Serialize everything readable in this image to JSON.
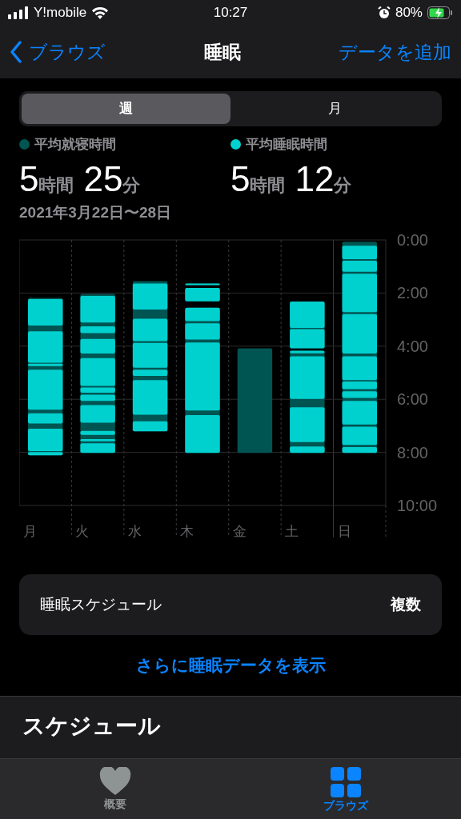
{
  "status_bar": {
    "carrier": "Y!mobile",
    "time": "10:27",
    "battery": "80%"
  },
  "nav": {
    "back": "ブラウズ",
    "title": "睡眠",
    "action": "データを追加"
  },
  "segments": [
    {
      "label": "週",
      "selected": true
    },
    {
      "label": "月",
      "selected": false
    }
  ],
  "stats": [
    {
      "label": "平均就寝時間",
      "color": "#005552",
      "hours": "5",
      "hours_unit": "時間",
      "minutes": "25",
      "minutes_unit": "分"
    },
    {
      "label": "平均睡眠時間",
      "color": "#00d1cf",
      "hours": "5",
      "hours_unit": "時間",
      "minutes": "12",
      "minutes_unit": "分"
    }
  ],
  "date_range": "2021年3月22日〜28日",
  "sleep_chart": {
    "y_labels": [
      "0:00",
      "2:00",
      "4:00",
      "6:00",
      "8:00",
      "10:00"
    ],
    "day_labels": [
      "月",
      "火",
      "水",
      "木",
      "金",
      "土",
      "日"
    ]
  },
  "schedule_row": {
    "label": "睡眠スケジュール",
    "value": "複数"
  },
  "more_link": "さらに睡眠データを表示",
  "section_heading": "スケジュール",
  "tab_bar": [
    {
      "label": "概要",
      "kind": "heart",
      "selected": false
    },
    {
      "label": "ブラウズ",
      "kind": "grid",
      "selected": true
    }
  ]
}
